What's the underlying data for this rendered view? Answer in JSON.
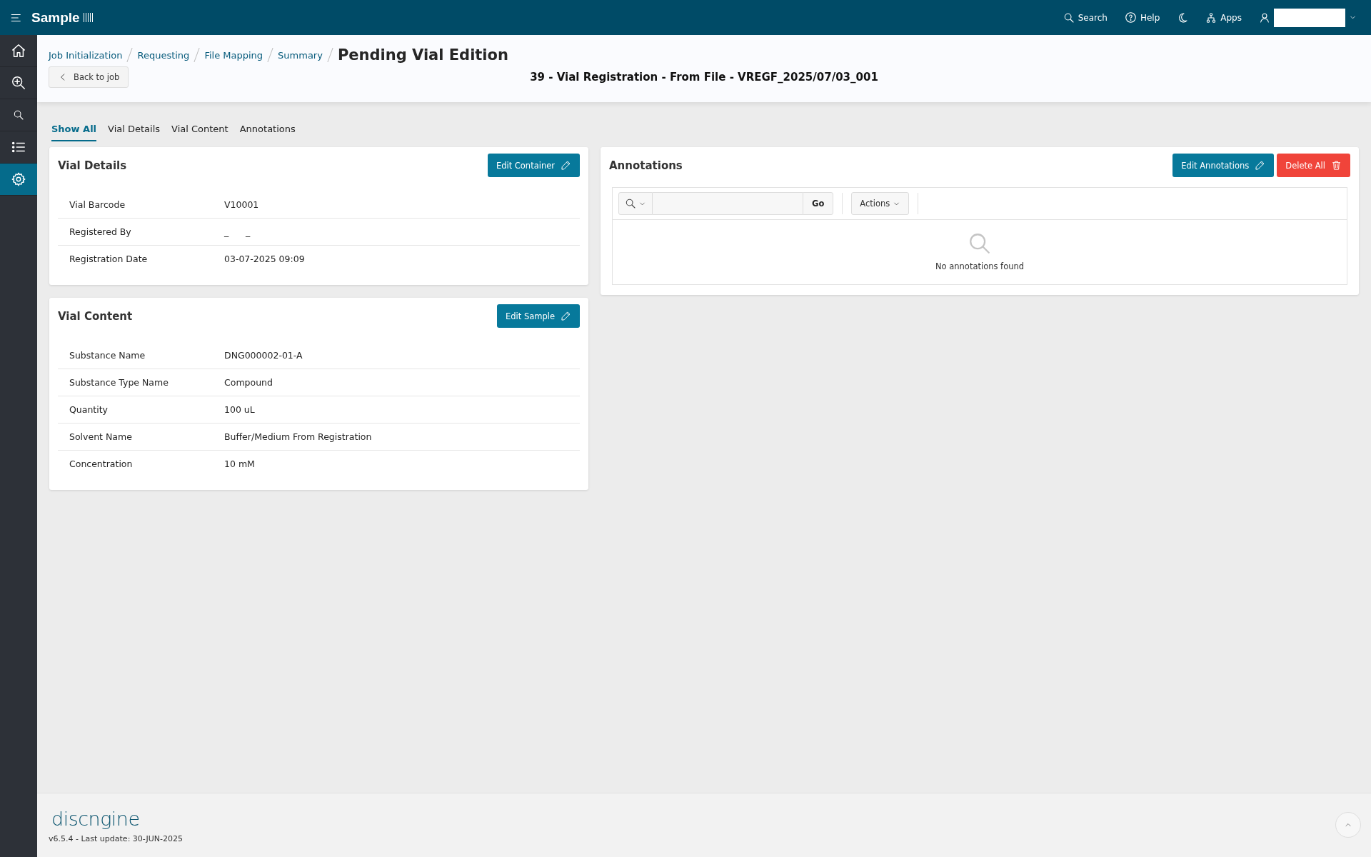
{
  "topbar": {
    "app_name": "Sample",
    "actions": [
      {
        "kind": "search",
        "label": "Search"
      },
      {
        "kind": "help",
        "label": "Help"
      },
      {
        "kind": "theme"
      },
      {
        "kind": "apps",
        "label": "Apps"
      },
      {
        "kind": "user"
      }
    ]
  },
  "sidebar": {
    "items": [
      {
        "kind": "home",
        "selected": false
      },
      {
        "kind": "zoom",
        "selected": false
      },
      {
        "kind": "search",
        "selected": false
      },
      {
        "kind": "list",
        "selected": false
      },
      {
        "kind": "settings",
        "selected": true
      }
    ]
  },
  "breadcrumbs": [
    "Job Initialization",
    "Requesting",
    "File Mapping",
    "Summary"
  ],
  "page_title": "Pending Vial Edition",
  "back_button": "Back to job",
  "job_title": "39 - Vial Registration - From File - VREGF_2025/07/03_001",
  "tabs": [
    {
      "label": "Show All",
      "selected": true
    },
    {
      "label": "Vial Details",
      "selected": false
    },
    {
      "label": "Vial Content",
      "selected": false
    },
    {
      "label": "Annotations",
      "selected": false
    }
  ],
  "vial_details": {
    "title": "Vial Details",
    "button": "Edit Container",
    "rows": [
      {
        "label": "Vial Barcode",
        "value": "V10001"
      },
      {
        "label": "Registered By",
        "value": "_      _"
      },
      {
        "label": "Registration Date",
        "value": "03-07-2025 09:09"
      }
    ]
  },
  "vial_content": {
    "title": "Vial Content",
    "button": "Edit Sample",
    "rows": [
      {
        "label": "Substance Name",
        "value": "DNG000002-01-A"
      },
      {
        "label": "Substance Type Name",
        "value": "Compound"
      },
      {
        "label": "Quantity",
        "value": "100 uL"
      },
      {
        "label": "Solvent Name",
        "value": "Buffer/Medium From Registration"
      },
      {
        "label": "Concentration",
        "value": "10 mM"
      }
    ]
  },
  "annotations": {
    "title": "Annotations",
    "edit_button": "Edit Annotations",
    "delete_button": "Delete All",
    "go_button": "Go",
    "actions_button": "Actions",
    "empty_message": "No annotations found"
  },
  "footer": {
    "logo": "discngine",
    "version": "v6.5.4 - Last update: 30-JUN-2025"
  }
}
